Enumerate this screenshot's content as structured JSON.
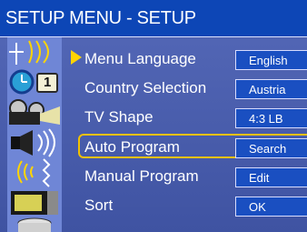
{
  "header": {
    "title": "SETUP MENU - SETUP"
  },
  "sidebar": {
    "tiles": [
      {
        "name": "antenna-icon"
      },
      {
        "name": "clock-icon"
      },
      {
        "name": "camera-projector-icon"
      },
      {
        "name": "speaker-icon"
      },
      {
        "name": "signal-icon"
      },
      {
        "name": "tv-icon"
      },
      {
        "name": "disc-stack-icon"
      }
    ],
    "clock_digit": "1"
  },
  "menu": {
    "items": [
      {
        "label": "Menu Language",
        "value": "English",
        "selected": true,
        "focused": false
      },
      {
        "label": "Country Selection",
        "value": "Austria",
        "selected": false,
        "focused": false
      },
      {
        "label": "TV Shape",
        "value": "4:3 LB",
        "selected": false,
        "focused": false
      },
      {
        "label": "Auto Program",
        "value": "Search",
        "selected": false,
        "focused": true
      },
      {
        "label": "Manual Program",
        "value": "Edit",
        "selected": false,
        "focused": false
      },
      {
        "label": "Sort",
        "value": "OK",
        "selected": false,
        "focused": false
      }
    ]
  },
  "colors": {
    "title_bar": "#0d46b6",
    "menu_bg": "#4b5fae",
    "highlight": "#f2c100",
    "pointer": "#ffd400"
  }
}
